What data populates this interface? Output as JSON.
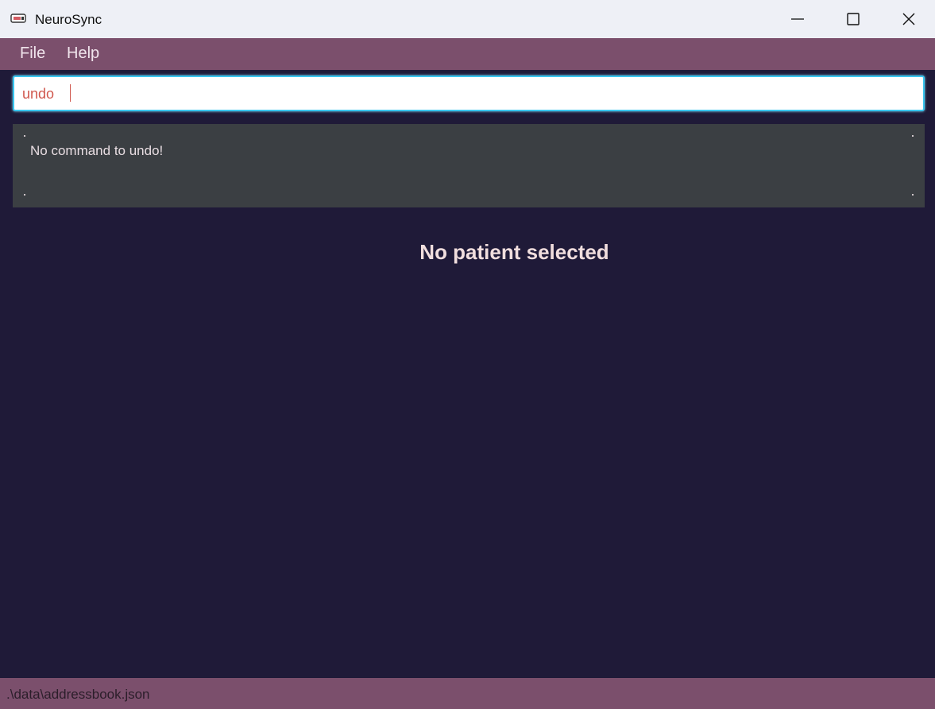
{
  "window": {
    "title": "NeuroSync",
    "app_icon": "app-logo-icon",
    "controls": {
      "minimize_icon": "minimize-icon",
      "maximize_icon": "maximize-icon",
      "close_icon": "close-icon"
    }
  },
  "menubar": {
    "items": [
      {
        "label": "File"
      },
      {
        "label": "Help"
      }
    ]
  },
  "command_box": {
    "value": "undo"
  },
  "result_display": {
    "text": "No command to undo!"
  },
  "main_panel": {
    "placeholder": "No patient selected"
  },
  "status_bar": {
    "file_path": ".\\data\\addressbook.json"
  },
  "colors": {
    "background": "#1f1a38",
    "menubar": "#7b4f6c",
    "result_box": "#3b3f43",
    "command_text": "#d0584e",
    "focus_border": "#39c6ef"
  }
}
